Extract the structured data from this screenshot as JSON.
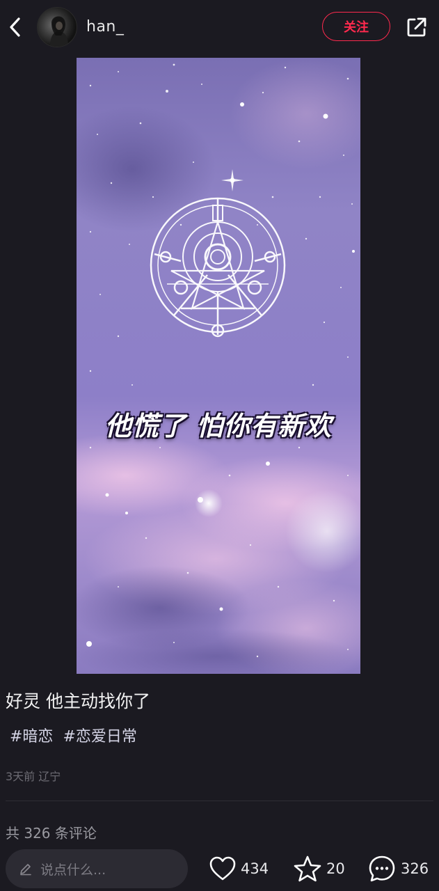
{
  "header": {
    "username": "han_",
    "follow_label": "关注"
  },
  "media": {
    "caption": "他慌了 怕你有新欢"
  },
  "post": {
    "title": "好灵  他主动找你了",
    "tags": [
      "#暗恋",
      "#恋爱日常"
    ],
    "meta": "3天前 辽宁"
  },
  "comments": {
    "count_label": "共 326 条评论"
  },
  "bottom_bar": {
    "input_placeholder": "说点什么...",
    "likes": "434",
    "favorites": "20",
    "comments": "326"
  },
  "icons": {
    "back": "chevron-left-icon",
    "share": "share-external-icon",
    "pen": "pencil-icon",
    "like": "heart-icon",
    "favorite": "star-icon",
    "comment": "comment-bubble-icon"
  },
  "colors": {
    "background": "#1b1a21",
    "accent": "#ff2a4e",
    "text_primary": "#f2f2f2",
    "text_muted": "#6d6c74"
  }
}
